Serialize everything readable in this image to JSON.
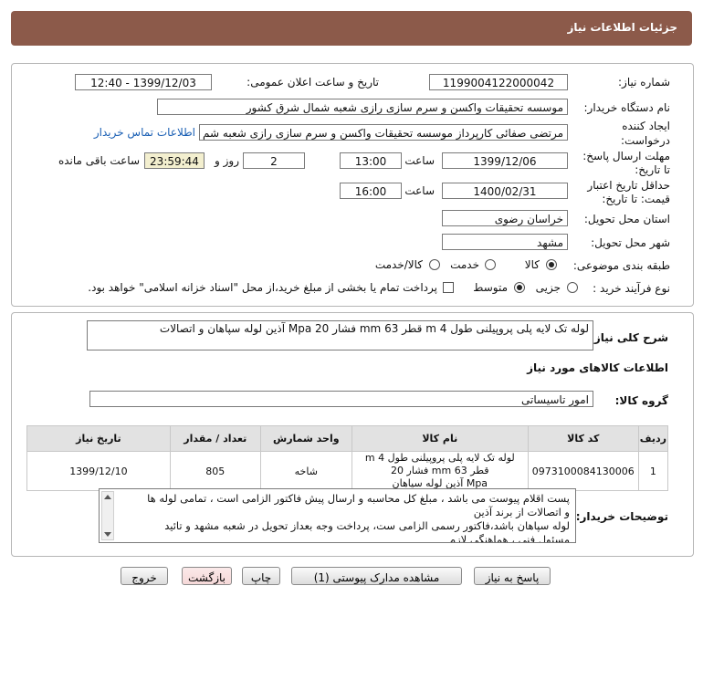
{
  "header": {
    "title": "جزئیات اطلاعات نیاز"
  },
  "details": {
    "need_number_label": "شماره نیاز:",
    "need_number": "1199004122000042",
    "announce_label": "تاریخ و ساعت اعلان عمومی:",
    "announce_value": "1399/12/03 - 12:40",
    "buyer_label": "نام دستگاه خریدار:",
    "buyer_value": "موسسه تحقیقات واکسن و سرم سازی رازی شعبه شمال شرق کشور",
    "creator_label_1": "ایجاد کننده",
    "creator_label_2": "درخواست:",
    "creator_value": "مرتضی صفائی کارپرداز موسسه تحقیقات واکسن و سرم سازی رازی شعبه شم",
    "contact_link": "اطلاعات تماس خریدار",
    "deadline_label_1": "مهلت ارسال پاسخ:",
    "deadline_label_2": "تا تاریخ:",
    "deadline_date": "1399/12/06",
    "time_label": "ساعت",
    "deadline_time": "13:00",
    "days_value": "2",
    "days_label": "روز و",
    "remaining_time": "23:59:44",
    "remaining_label": "ساعت باقی مانده",
    "validity_label_1": "حداقل تاریخ اعتبار",
    "validity_label_2": "قیمت: تا تاریخ:",
    "validity_date": "1400/02/31",
    "validity_time_label": "ساعت",
    "validity_time": "16:00",
    "province_label": "استان محل تحویل:",
    "province_value": "خراسان رضوی",
    "city_label": "شهر محل تحویل:",
    "city_value": "مشهد",
    "category_label": "طبقه بندی موضوعی:",
    "category_options": [
      "کالا",
      "خدمت",
      "کالا/خدمت"
    ],
    "process_label": "نوع فرآیند خرید :",
    "process_options": [
      "جزیی",
      "متوسط"
    ],
    "payment_note": "پرداخت تمام یا بخشی از مبلغ خرید،از محل \"اسناد خزانه اسلامی\" خواهد بود."
  },
  "description": {
    "label": "شرح کلی نیاز:",
    "value": "لوله تک لایه پلی پروپیلنی طول 4 m قطر 63 mm فشار 20 Mpa آذین لوله سپاهان و اتصالات"
  },
  "goods": {
    "section_title": "اطلاعات کالاهای مورد نیاز",
    "group_label": "گروه کالا:",
    "group_value": "امور تاسیساتی",
    "columns": [
      "ردیف",
      "کد کالا",
      "نام کالا",
      "واحد شمارش",
      "تعداد / مقدار",
      "تاریخ نیاز"
    ],
    "rows": [
      {
        "index": "1",
        "code": "0973100084130006",
        "name_line1": "لوله تک لایه پلی پروپیلنی طول 4 m قطر 63 mm فشار 20",
        "name_line2": "Mpa آذین لوله سپاهان",
        "unit": "شاخه",
        "qty": "805",
        "date": "1399/12/10"
      }
    ]
  },
  "buyer_notes": {
    "label": "توضیحات خریدار:",
    "line1": "پست اقلام پیوست می باشد ، مبلغ کل محاسبه و ارسال پیش فاکتور الزامی است ، تمامی لوله ها",
    "line2": "و اتصالات از برند آذین",
    "line3": "لوله سپاهان باشد،فاکتور رسمی الزامی ست، پرداخت وجه بعداز تحویل در شعبه مشهد و تائید",
    "line4": "مسئول فنی ، هماهنگی لازم"
  },
  "buttons": {
    "reply": "پاسخ به نیاز",
    "attachments": "مشاهده مدارک پیوستی (1)",
    "print": "چاپ",
    "back": "بازگشت",
    "exit": "خروج"
  },
  "colors": {
    "titlebar": "#8c5a4a",
    "link": "#1a5fb4",
    "remaining_bg": "#f3efcf",
    "back_button": "#f6d9d9"
  }
}
